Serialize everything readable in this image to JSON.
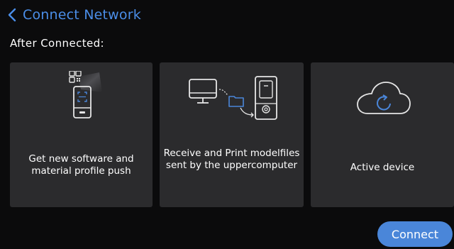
{
  "header": {
    "back_icon": "chevron-left-icon",
    "title": "Connect Network"
  },
  "subtitle": "After Connected:",
  "cards": [
    {
      "icon": "qr-device-icon",
      "label": "Get new software and material profile push"
    },
    {
      "icon": "computer-to-printer-icon",
      "label": "Receive and Print modelfiles sent by the uppercomputer"
    },
    {
      "icon": "cloud-sync-icon",
      "label": "Active device"
    }
  ],
  "footer": {
    "connect_label": "Connect"
  },
  "colors": {
    "accent": "#4a86d9",
    "title": "#4b8ee8",
    "card_bg": "#2b2b2d",
    "screen_bg": "#0b0b0c"
  }
}
